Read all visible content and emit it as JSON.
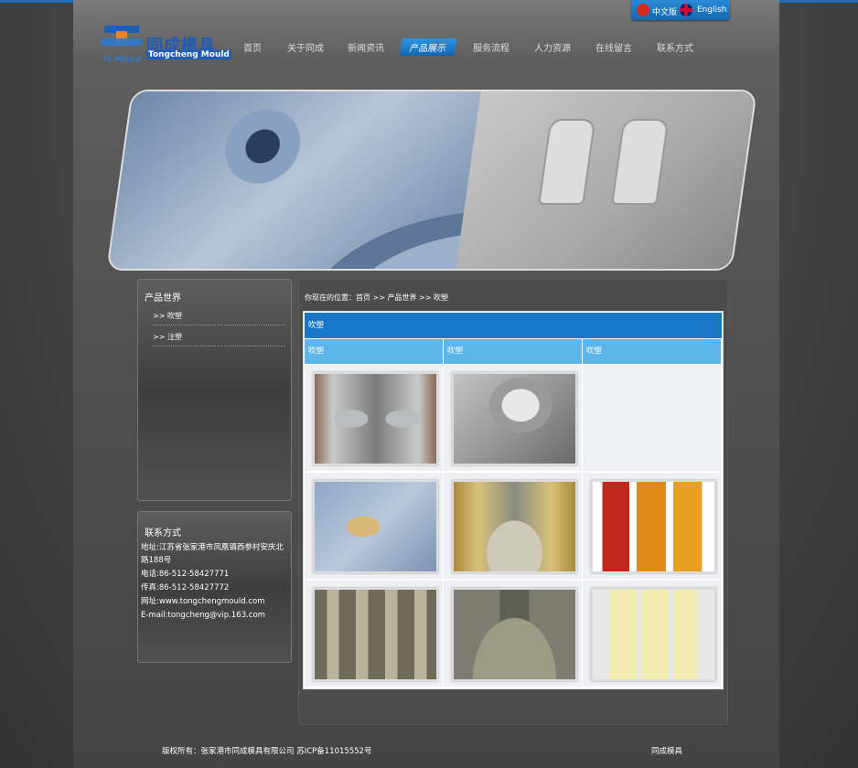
{
  "lang": {
    "cn": "中文版",
    "en": "English"
  },
  "logo": {
    "cn": "同成模具",
    "en": "Tongcheng Mould",
    "mark": "TC MOULD"
  },
  "nav": [
    "首页",
    "关于同成",
    "新闻资讯",
    "产品展示",
    "服务流程",
    "人力资源",
    "在线留言",
    "联系方式"
  ],
  "sidebar": {
    "title": "产品世界",
    "links": [
      ">> 吹塑",
      ">> 注塑"
    ]
  },
  "contact": {
    "title": "联系方式",
    "address": "地址:江苏省张家港市凤凰镇西参村安庆北路188号",
    "phone": "电话:86-512-58427771",
    "fax": "传真:86-512-58427772",
    "web": "网址:www.tongchengmould.com",
    "email": "E-mail:tongcheng@vip.163.com"
  },
  "breadcrumb": "你现在的位置：首页 >> 产品世界 >> 吹塑",
  "table": {
    "header": "吹塑",
    "columns": [
      "吹塑",
      "吹塑",
      "吹塑"
    ]
  },
  "footer": {
    "copyright": "版权所有：张家港市同成模具有限公司  苏ICP备11015552号",
    "brand": "同成模具"
  }
}
